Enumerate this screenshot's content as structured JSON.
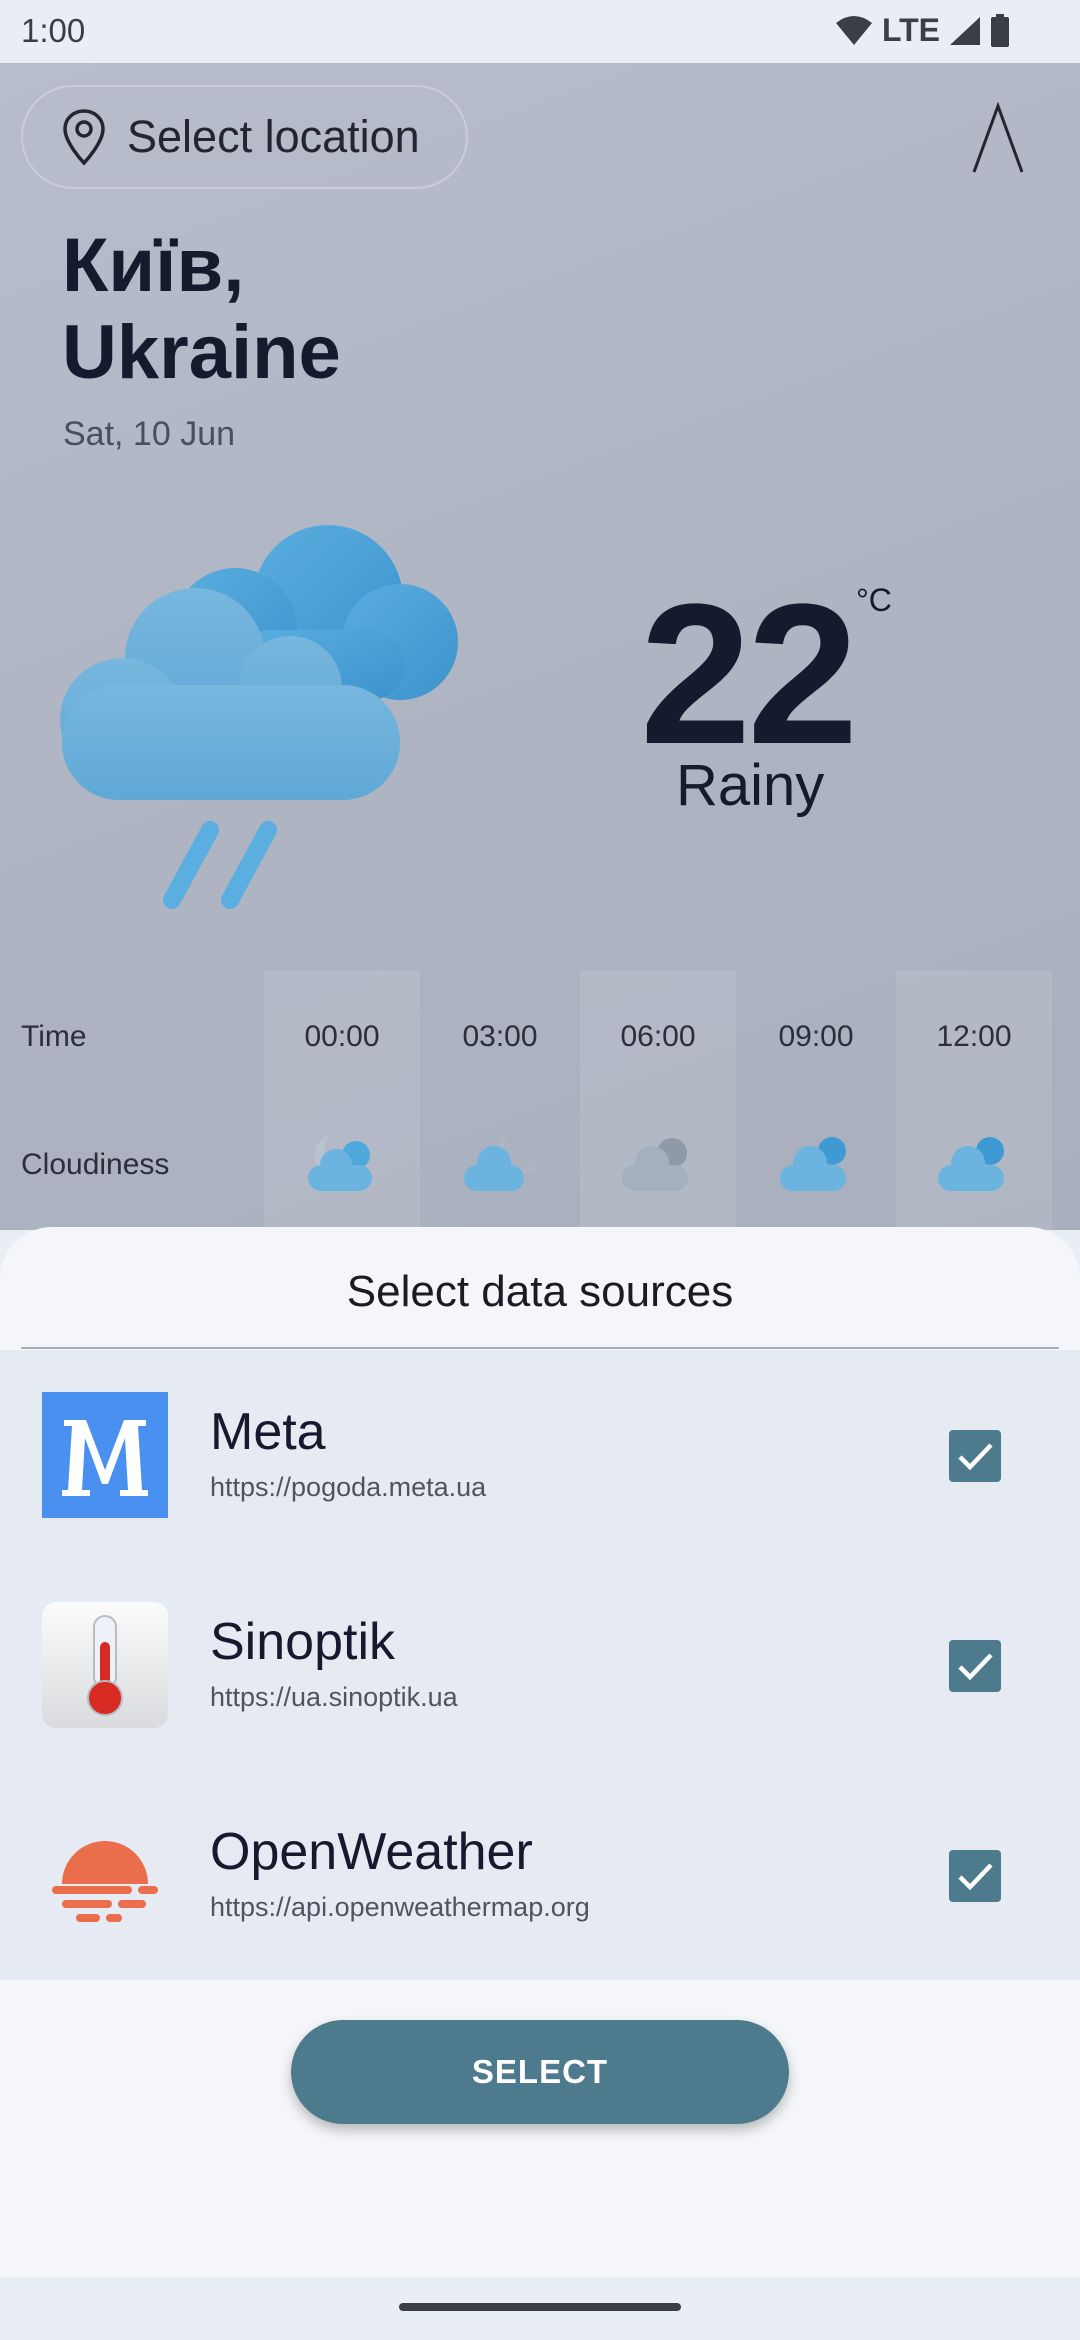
{
  "status_bar": {
    "time": "1:00",
    "network": "LTE"
  },
  "header": {
    "location_placeholder": "Select location",
    "font_button": "A"
  },
  "weather": {
    "city_line1": "Київ,",
    "city_line2": "Ukraine",
    "date": "Sat, 10 Jun",
    "temperature": "22",
    "unit": "°C",
    "condition": "Rainy",
    "icon": "cloud-rain-icon"
  },
  "forecast": {
    "time_label": "Time",
    "cloudiness_label": "Cloudiness",
    "times": [
      "00:00",
      "03:00",
      "06:00",
      "09:00",
      "12:00"
    ],
    "icons": [
      "night-cloud-icon",
      "moon-cloud-icon",
      "overcast-icon",
      "cloud-icon",
      "cloud-icon"
    ]
  },
  "sheet": {
    "title": "Select data sources",
    "sources": [
      {
        "name": "Meta",
        "url": "https://pogoda.meta.ua",
        "logo": "meta-logo",
        "checked": true
      },
      {
        "name": "Sinoptik",
        "url": "https://ua.sinoptik.ua",
        "logo": "thermometer-logo",
        "checked": true
      },
      {
        "name": "OpenWeather",
        "url": "https://api.openweathermap.org",
        "logo": "openweather-logo",
        "checked": true
      }
    ],
    "button_label": "SELECT"
  },
  "colors": {
    "accent": "#4d7b8d",
    "cloud": "#5aa9d6",
    "meta_blue": "#4a90f0",
    "openweather_orange": "#ea6e4b"
  }
}
